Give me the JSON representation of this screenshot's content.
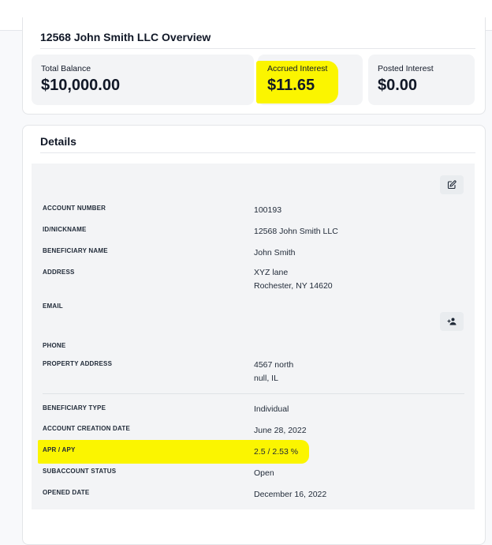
{
  "overview": {
    "title": "12568 John Smith LLC Overview",
    "stats": [
      {
        "label": "Total Balance",
        "value": "$10,000.00"
      },
      {
        "label": "Accrued Interest",
        "value": "$11.65"
      },
      {
        "label": "Posted Interest",
        "value": "$0.00"
      }
    ],
    "highlight_color": "#fbf500"
  },
  "details": {
    "title": "Details",
    "rows": [
      {
        "label": "ACCOUNT NUMBER",
        "value": "100193"
      },
      {
        "label": "ID/NICKNAME",
        "value": "12568 John Smith LLC"
      },
      {
        "label": "BENEFICIARY NAME",
        "value": "John Smith"
      },
      {
        "label": "ADDRESS",
        "value_lines": [
          "XYZ lane",
          "Rochester, NY 14620"
        ]
      },
      {
        "label": "EMAIL",
        "value": ""
      },
      {
        "label": "PHONE",
        "value": ""
      },
      {
        "label": "PROPERTY ADDRESS",
        "value_lines": [
          "4567 north",
          "null, IL"
        ]
      },
      {
        "label": "BENEFICIARY TYPE",
        "value": "Individual"
      },
      {
        "label": "ACCOUNT CREATION DATE",
        "value": "June 28, 2022"
      },
      {
        "label": "APR / APY",
        "value": "2.5 / 2.53 %"
      },
      {
        "label": "SUBACCOUNT STATUS",
        "value": "Open"
      },
      {
        "label": "OPENED DATE",
        "value": "December 16, 2022"
      }
    ],
    "icons": {
      "edit": "edit-icon",
      "add_user": "person-add-icon"
    }
  }
}
